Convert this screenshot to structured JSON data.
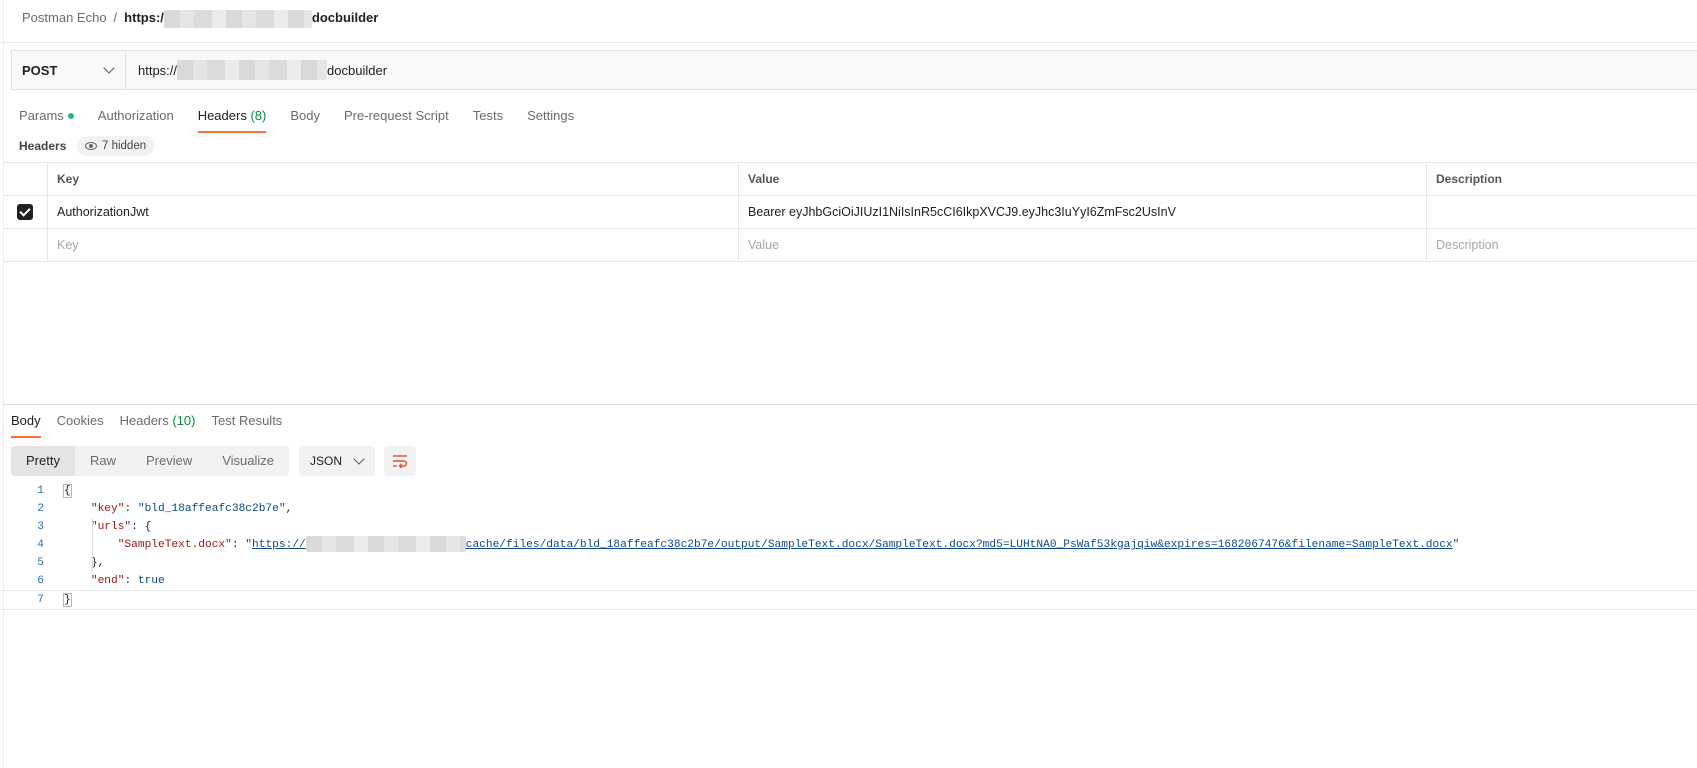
{
  "breadcrumb": {
    "collection": "Postman Echo",
    "separator": "/",
    "url_prefix": "https:/",
    "url_suffix": "docbuilder"
  },
  "request": {
    "method": "POST",
    "url_prefix": "https://",
    "url_suffix": "docbuilder"
  },
  "request_tabs": [
    {
      "label": "Params",
      "count": "",
      "dot": true,
      "active": false
    },
    {
      "label": "Authorization",
      "count": "",
      "dot": false,
      "active": false
    },
    {
      "label": "Headers",
      "count": "(8)",
      "dot": false,
      "active": true
    },
    {
      "label": "Body",
      "count": "",
      "dot": false,
      "active": false
    },
    {
      "label": "Pre-request Script",
      "count": "",
      "dot": false,
      "active": false
    },
    {
      "label": "Tests",
      "count": "",
      "dot": false,
      "active": false
    },
    {
      "label": "Settings",
      "count": "",
      "dot": false,
      "active": false
    }
  ],
  "headers_section": {
    "label": "Headers",
    "hidden_label": "7 hidden"
  },
  "headers_table": {
    "columns": [
      "Key",
      "Value",
      "Description"
    ],
    "rows": [
      {
        "checked": true,
        "key": "AuthorizationJwt",
        "value": "Bearer eyJhbGciOiJIUzI1NiIsInR5cCI6IkpXVCJ9.eyJhc3IuYyI6ZmFsc2UsInV",
        "description": ""
      }
    ],
    "placeholders": {
      "key": "Key",
      "value": "Value",
      "description": "Description"
    }
  },
  "response_tabs": [
    {
      "label": "Body",
      "count": "",
      "active": true
    },
    {
      "label": "Cookies",
      "count": "",
      "active": false
    },
    {
      "label": "Headers",
      "count": "(10)",
      "active": false
    },
    {
      "label": "Test Results",
      "count": "",
      "active": false
    }
  ],
  "view_modes": [
    {
      "label": "Pretty",
      "active": true
    },
    {
      "label": "Raw",
      "active": false
    },
    {
      "label": "Preview",
      "active": false
    },
    {
      "label": "Visualize",
      "active": false
    }
  ],
  "format": "JSON",
  "response_body": {
    "line_numbers": [
      "1",
      "2",
      "3",
      "4",
      "5",
      "6",
      "7"
    ],
    "open_brace": "{",
    "close_brace": "}",
    "key_key": "\"key\"",
    "key_value": "\"bld_18affeafc38c2b7e\"",
    "urls_key": "\"urls\"",
    "file_key": "\"SampleText.docx\"",
    "url_quote_open": "\"",
    "url_prefix": "https://",
    "url_suffix": "cache/files/data/bld_18affeafc38c2b7e/output/SampleText.docx/SampleText.docx?md5=LUHtNA0_PsWaf53kgajqiw&expires=1682067476&filename=SampleText.docx",
    "url_quote_close": "\"",
    "urls_close": "},",
    "end_key": "\"end\"",
    "end_value": "true"
  },
  "colors": {
    "accent": "#ff6c37",
    "dot": "#26b47f",
    "json_key": "#a31515",
    "json_string": "#0b4a8a"
  },
  "icons": [
    "chevron-down-icon",
    "eye-icon",
    "checkbox-checked-icon",
    "wrap-lines-icon"
  ]
}
